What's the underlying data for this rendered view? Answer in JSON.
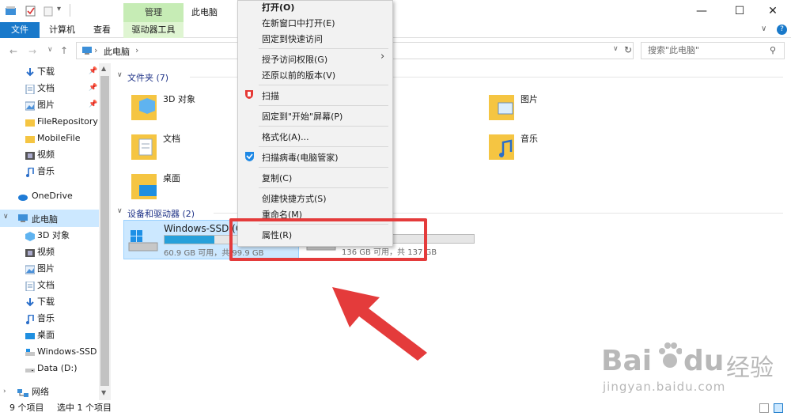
{
  "window": {
    "title": "此电脑"
  },
  "ribbon": {
    "manage_label": "管理",
    "drive_tools_label": "驱动器工具",
    "tabs": [
      {
        "label": "文件"
      },
      {
        "label": "计算机"
      },
      {
        "label": "查看"
      }
    ]
  },
  "address": {
    "path": "此电脑",
    "search_placeholder": "搜索\"此电脑\""
  },
  "nav": {
    "quick": [
      {
        "label": "下载",
        "pinned": true
      },
      {
        "label": "文档",
        "pinned": true
      },
      {
        "label": "图片",
        "pinned": true
      },
      {
        "label": "FileRepository"
      },
      {
        "label": "MobileFile"
      },
      {
        "label": "视频"
      },
      {
        "label": "音乐"
      }
    ],
    "onedrive": "OneDrive",
    "thispc": "此电脑",
    "pc_items": [
      {
        "label": "3D 对象"
      },
      {
        "label": "视频"
      },
      {
        "label": "图片"
      },
      {
        "label": "文档"
      },
      {
        "label": "下载"
      },
      {
        "label": "音乐"
      },
      {
        "label": "桌面"
      },
      {
        "label": "Windows-SSD ("
      },
      {
        "label": "Data (D:)"
      }
    ],
    "network": "网络"
  },
  "content": {
    "folders_header": "文件夹 (7)",
    "folders": [
      "3D 对象",
      "文档",
      "桌面",
      "图片",
      "音乐"
    ],
    "drives_header": "设备和驱动器 (2)",
    "drives": [
      {
        "name": "Windows-SSD (C",
        "free": "60.9 GB 可用，共 99.9 GB",
        "usage": 0.4
      },
      {
        "name": "",
        "free": "136 GB 可用，共 137 GB",
        "usage": 0.01
      }
    ]
  },
  "context_menu": {
    "items": [
      {
        "label": "打开(O)"
      },
      {
        "label": "在新窗口中打开(E)"
      },
      {
        "label": "固定到快速访问"
      },
      {
        "label": "授予访问权限(G)"
      },
      {
        "label": "还原以前的版本(V)"
      },
      {
        "label": "扫描"
      },
      {
        "label": "固定到\"开始\"屏幕(P)"
      },
      {
        "label": "格式化(A)..."
      },
      {
        "label": "扫描病毒(电脑管家)"
      },
      {
        "label": "复制(C)"
      },
      {
        "label": "创建快捷方式(S)"
      },
      {
        "label": "重命名(M)"
      },
      {
        "label": "属性(R)"
      }
    ]
  },
  "status": {
    "item_count": "9 个项目",
    "selected": "选中 1 个项目"
  },
  "watermark": {
    "brand_left": "Bai",
    "brand_right": "du",
    "cn": "经验",
    "url": "jingyan.baidu.com"
  },
  "colors": {
    "accent": "#1979ca",
    "highlight": "#cce8ff",
    "red": "#e43b3b",
    "folder": "#f5c542"
  }
}
